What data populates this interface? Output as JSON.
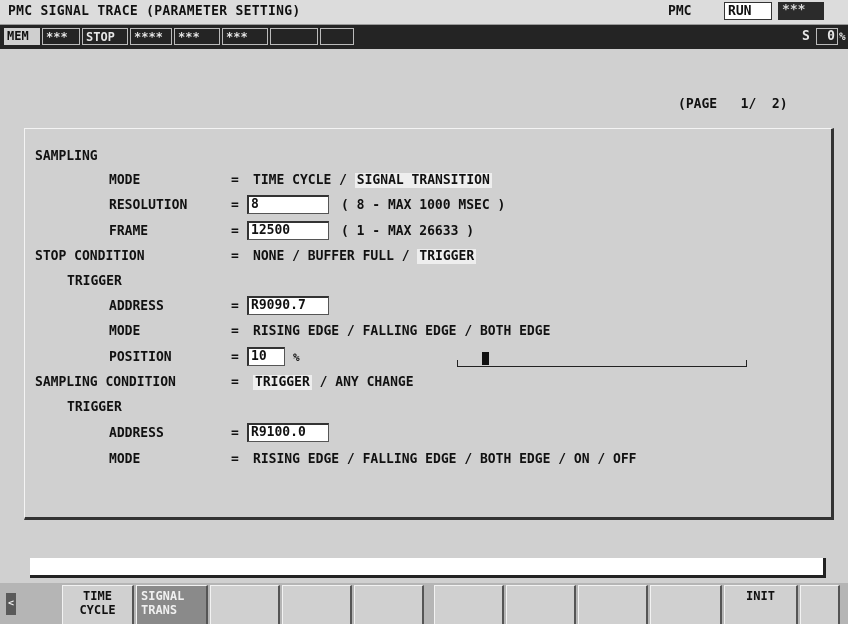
{
  "title": "PMC SIGNAL TRACE (PARAMETER SETTING)",
  "pmc": {
    "label": "PMC",
    "state": "RUN",
    "alarm": "***"
  },
  "status": {
    "mode": "MEM",
    "f1": "***",
    "run": "STOP",
    "f2": "****",
    "f3": "***",
    "f4": "***",
    "f5": "",
    "s_label": "S",
    "override": "0",
    "pct": "%"
  },
  "page": {
    "text": "(PAGE   1/  2)"
  },
  "sampling": {
    "header": "SAMPLING",
    "mode_label": "MODE",
    "mode_eq": "=",
    "mode_opt1": "TIME CYCLE",
    "mode_sep": " / ",
    "mode_opt2": "SIGNAL TRANSITION",
    "resolution_label": "RESOLUTION",
    "resolution_value": "8",
    "resolution_range": "( 8 - MAX 1000 MSEC )",
    "frame_label": "FRAME",
    "frame_value": "12500",
    "frame_range": "( 1 - MAX 26633 )"
  },
  "stop_condition": {
    "header": "STOP CONDITION",
    "eq": "=",
    "opt1": "NONE",
    "opt2": "BUFFER FULL",
    "opt3": "TRIGGER",
    "sep": " / ",
    "trigger_header": "TRIGGER",
    "address_label": "ADDRESS",
    "address_value": "R9090.7",
    "mode_label": "MODE",
    "mode_text": "RISING EDGE / FALLING EDGE / BOTH EDGE",
    "position_label": "POSITION",
    "position_value": "10",
    "position_unit": "%",
    "position_fraction": 0.1
  },
  "sampling_condition": {
    "header": "SAMPLING CONDITION",
    "eq": "=",
    "opt1": "TRIGGER",
    "opt2": "ANY CHANGE",
    "sep": " / ",
    "trigger_header": "TRIGGER",
    "address_label": "ADDRESS",
    "address_value": "R9100.0",
    "mode_label": "MODE",
    "mode_text": "RISING EDGE / FALLING EDGE / BOTH EDGE / ON / OFF"
  },
  "softkeys": {
    "left_arrow": "<",
    "k1_line1": "TIME",
    "k1_line2": "CYCLE",
    "k2_line1": "SIGNAL",
    "k2_line2": "TRANS",
    "k10": "INIT"
  }
}
